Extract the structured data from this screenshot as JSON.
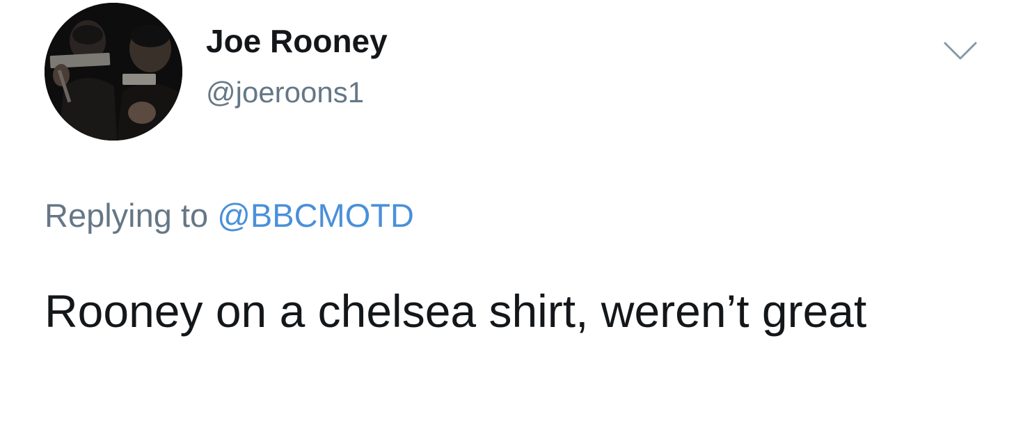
{
  "tweet": {
    "display_name": "Joe Rooney",
    "handle": "@joeroons1",
    "replying_prefix": "Replying to",
    "replying_to": "@BBCMOTD",
    "text": "Rooney on a chelsea shirt, weren’t great",
    "menu_icon": "chevron-down-icon",
    "avatar": "profile-photo"
  },
  "colors": {
    "name": "#14171a",
    "secondary": "#657786",
    "link": "#4a90d9",
    "caret": "#8899a6",
    "background": "#ffffff"
  }
}
